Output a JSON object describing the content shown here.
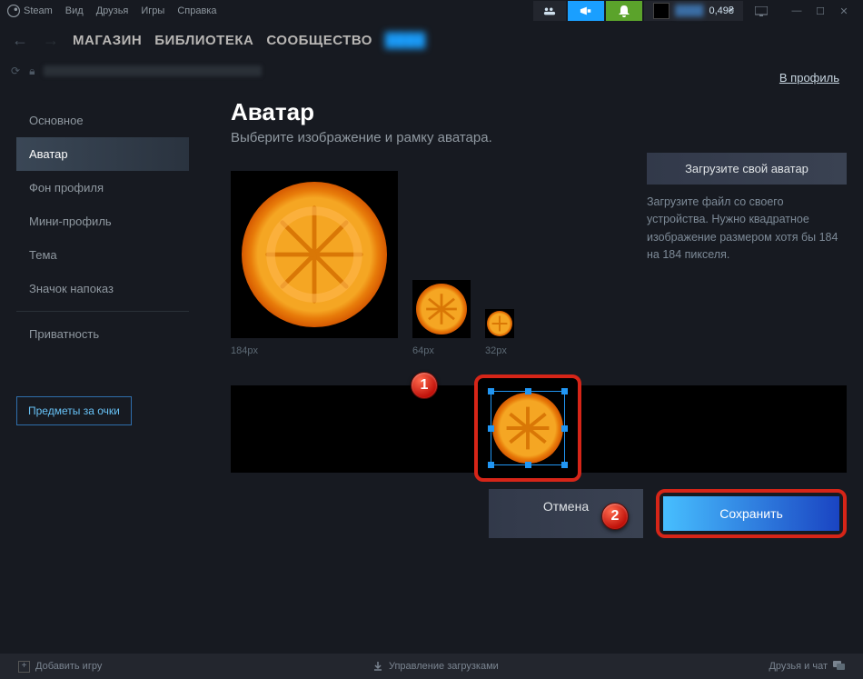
{
  "titlebar": {
    "app": "Steam",
    "menu": [
      "Вид",
      "Друзья",
      "Игры",
      "Справка"
    ],
    "balance": "0,49₴"
  },
  "nav": {
    "store": "МАГАЗИН",
    "library": "БИБЛИОТЕКА",
    "community": "СООБЩЕСТВО"
  },
  "profile_link": "В профиль",
  "sidebar": {
    "items": [
      "Основное",
      "Аватар",
      "Фон профиля",
      "Мини-профиль",
      "Тема",
      "Значок напоказ"
    ],
    "privacy": "Приватность",
    "points_btn": "Предметы за очки"
  },
  "page": {
    "title": "Аватар",
    "subtitle": "Выберите изображение и рамку аватара.",
    "sizes": {
      "large": "184px",
      "medium": "64px",
      "small": "32px"
    }
  },
  "upload": {
    "button": "Загрузите свой аватар",
    "desc": "Загрузите файл со своего устройства. Нужно квадратное изображение размером хотя бы 184 на 184 пикселя."
  },
  "actions": {
    "cancel": "Отмена",
    "save": "Сохранить"
  },
  "annotations": {
    "one": "1",
    "two": "2"
  },
  "statusbar": {
    "add_game": "Добавить игру",
    "downloads": "Управление загрузками",
    "friends": "Друзья и чат"
  }
}
